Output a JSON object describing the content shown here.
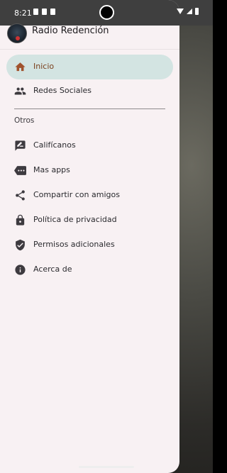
{
  "status_bar": {
    "time": "8:21"
  },
  "drawer": {
    "title": "Radio Redención",
    "items": [
      {
        "label": "Inicio",
        "icon": "home-icon",
        "active": true
      },
      {
        "label": "Redes Sociales",
        "icon": "people-icon"
      }
    ],
    "section_label": "Otros",
    "other_items": [
      {
        "label": "Califícanos",
        "icon": "rate-icon"
      },
      {
        "label": "Mas apps",
        "icon": "more-apps-icon"
      },
      {
        "label": "Compartir con amigos",
        "icon": "share-icon"
      },
      {
        "label": "Política de privacidad",
        "icon": "lock-icon"
      },
      {
        "label": "Permisos adicionales",
        "icon": "shield-check-icon"
      },
      {
        "label": "Acerca de",
        "icon": "info-icon"
      }
    ]
  },
  "colors": {
    "drawer_bg": "#f8f1f3",
    "active_bg": "#d3e4e2",
    "active_text": "#7a3f1b",
    "icon": "#3d3a3f",
    "home_icon": "#a0522d"
  }
}
